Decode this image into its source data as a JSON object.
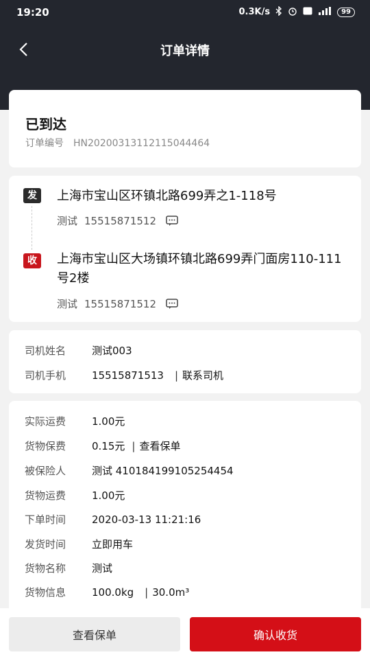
{
  "statusbar": {
    "time": "19:20",
    "speed": "0.3K/s",
    "battery": "99"
  },
  "nav": {
    "title": "订单详情"
  },
  "order": {
    "status": "已到达",
    "no_label": "订单编号",
    "no_value": "HN20200313112115044464"
  },
  "route": {
    "send_tag": "发",
    "send_address": "上海市宝山区环镇北路699弄之1-118号",
    "send_name": "测试",
    "send_phone": "15515871512",
    "recv_tag": "收",
    "recv_address": "上海市宝山区大场镇环镇北路699弄门面房110-111号2楼",
    "recv_name": "测试",
    "recv_phone": "15515871512"
  },
  "driver": {
    "name_label": "司机姓名",
    "name_value": "测试003",
    "phone_label": "司机手机",
    "phone_value": "15515871513",
    "sep": "|",
    "contact_link": "联系司机"
  },
  "details": {
    "actual_fee_label": "实际运费",
    "actual_fee_value": "1.00元",
    "insurance_label": "货物保费",
    "insurance_value": "0.15元",
    "sep": "|",
    "insurance_link": "查看保单",
    "insured_label": "被保险人",
    "insured_value": "测试 410184199105254454",
    "cargo_fee_label": "货物运费",
    "cargo_fee_value": "1.00元",
    "order_time_label": "下单时间",
    "order_time_value": "2020-03-13 11:21:16",
    "ship_time_label": "发货时间",
    "ship_time_value": "立即用车",
    "cargo_name_label": "货物名称",
    "cargo_name_value": "测试",
    "cargo_info_label": "货物信息",
    "cargo_weight": "100.0kg",
    "cargo_volume": "30.0m³"
  },
  "actions": {
    "view_policy": "查看保单",
    "confirm_receipt": "确认收货"
  },
  "colors": {
    "header_bg": "#23262e",
    "primary_red": "#d40f17",
    "recv_tag_red": "#c8161d"
  }
}
